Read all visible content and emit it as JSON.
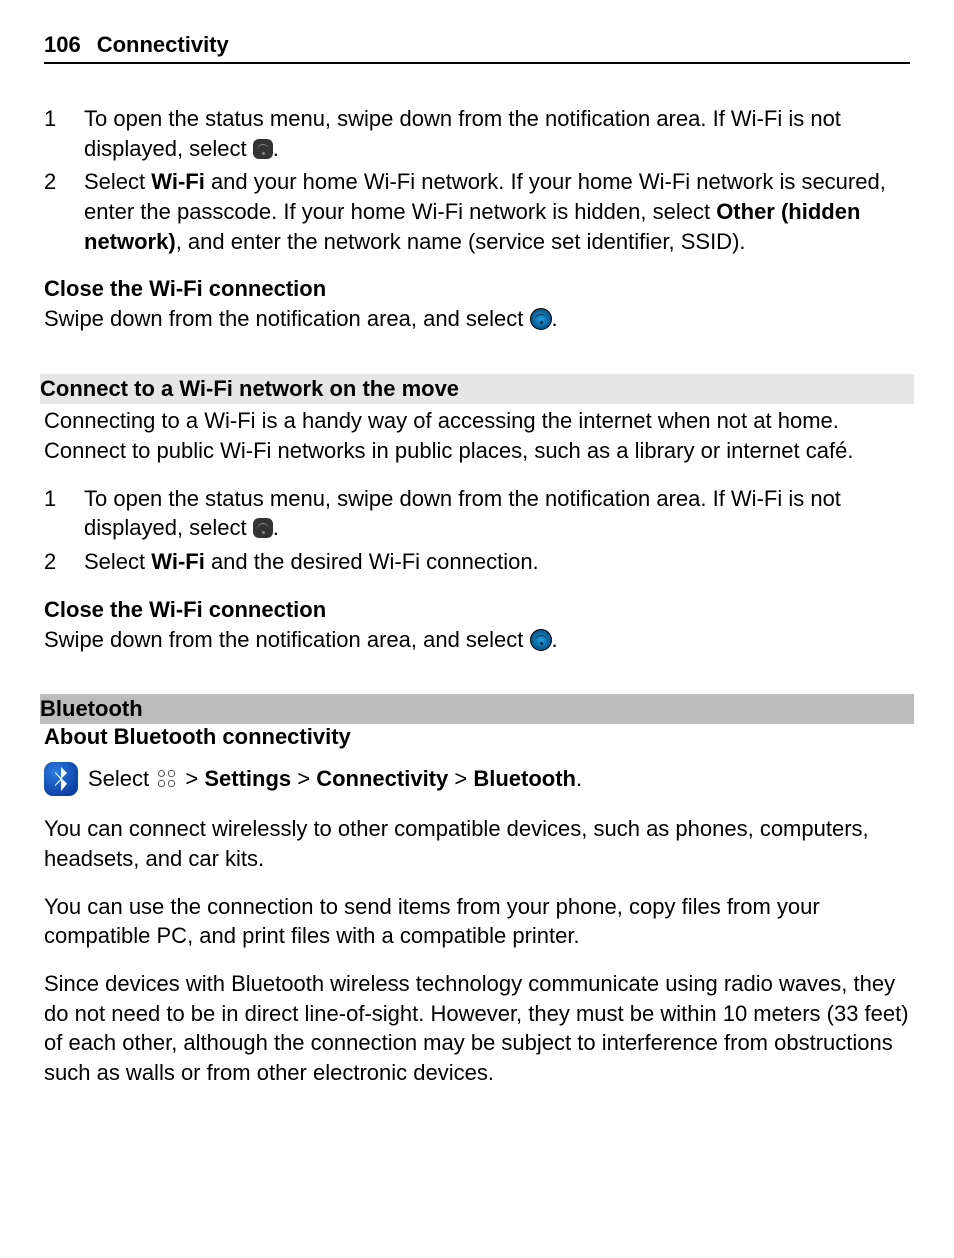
{
  "header": {
    "page_number": "106",
    "title": "Connectivity"
  },
  "list1": {
    "step1_num": "1",
    "step1_a": "To open the status menu, swipe down from the notification area. If Wi-Fi is not displayed, select ",
    "step1_b": ".",
    "step2_num": "2",
    "step2_a": "Select ",
    "step2_wifi": "Wi-Fi",
    "step2_b": " and your home Wi-Fi network. If your home Wi-Fi network is secured, enter the passcode. If your home Wi-Fi network is hidden, select ",
    "step2_other": "Other (hidden network)",
    "step2_c": ", and enter the network name (service set identifier, SSID)."
  },
  "close1": {
    "heading": "Close the Wi-Fi connection",
    "text_a": "Swipe down from the notification area, and select ",
    "text_b": "."
  },
  "section_move": {
    "bar": "Connect to a Wi-Fi network on the move",
    "intro": "Connecting to a Wi-Fi is a handy way of accessing the internet when not at home. Connect to public Wi-Fi networks in public places, such as a library or internet café."
  },
  "list2": {
    "step1_num": "1",
    "step1_a": "To open the status menu, swipe down from the notification area. If Wi-Fi is not displayed, select ",
    "step1_b": ".",
    "step2_num": "2",
    "step2_a": "Select ",
    "step2_wifi": "Wi-Fi",
    "step2_b": " and the desired Wi-Fi connection."
  },
  "close2": {
    "heading": "Close the Wi-Fi connection",
    "text_a": "Swipe down from the notification area, and select ",
    "text_b": "."
  },
  "bluetooth": {
    "bar": "Bluetooth",
    "about_heading": "About Bluetooth connectivity",
    "select_word": "Select ",
    "gt1": " > ",
    "settings": "Settings",
    "gt2": " > ",
    "connectivity": "Connectivity",
    "gt3": " > ",
    "bluetooth_word": "Bluetooth",
    "period": ".",
    "p1": "You can connect wirelessly to other compatible devices, such as phones, computers, headsets, and car kits.",
    "p2": "You can use the connection to send items from your phone, copy files from your compatible PC, and print files with a compatible printer.",
    "p3": "Since devices with Bluetooth wireless technology communicate using radio waves, they do not need to be in direct line-of-sight. However, they must be within 10 meters (33 feet) of each other, although the connection may be subject to interference from obstructions such as walls or from other electronic devices."
  }
}
